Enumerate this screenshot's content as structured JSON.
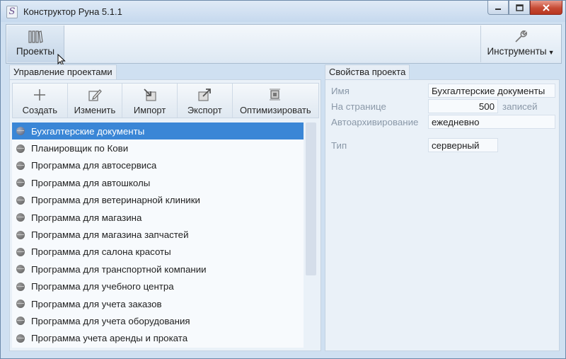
{
  "window": {
    "title": "Конструктор Руна 5.1.1",
    "app_icon_glyph": "S",
    "controls": {
      "minimize": "minimize-icon",
      "maximize": "maximize-icon",
      "close": "close-icon"
    }
  },
  "ribbon": {
    "projects_label": "Проекты",
    "tools_label": "Инструменты",
    "tools_has_dropdown": true
  },
  "left_panel": {
    "tab_label": "Управление проектами",
    "toolbar": {
      "create": "Создать",
      "edit": "Изменить",
      "import": "Импорт",
      "export": "Экспорт",
      "optimize": "Оптимизировать"
    },
    "projects": [
      "Бухгалтерские документы",
      "Планировщик по Кови",
      "Программа для автосервиса",
      "Программа для автошколы",
      "Программа для ветеринарной клиники",
      "Программа для магазина",
      "Программа для магазина запчастей",
      "Программа для салона красоты",
      "Программа для транспортной компании",
      "Программа для учебного центра",
      "Программа для учета заказов",
      "Программа для учета оборудования",
      "Программа учета аренды и проката"
    ],
    "selected_index": 0
  },
  "right_panel": {
    "tab_label": "Свойства проекта",
    "fields": {
      "name_label": "Имя",
      "name_value": "Бухгалтерские документы",
      "per_page_label": "На странице",
      "per_page_value": "500",
      "per_page_suffix": "записей",
      "autoarchive_label": "Автоархивирование",
      "autoarchive_value": "ежедневно",
      "type_label": "Тип",
      "type_value": "серверный"
    }
  },
  "colors": {
    "selection": "#3a86d6",
    "window_bg": "#cfe0f1",
    "close_button": "#c64a34"
  }
}
